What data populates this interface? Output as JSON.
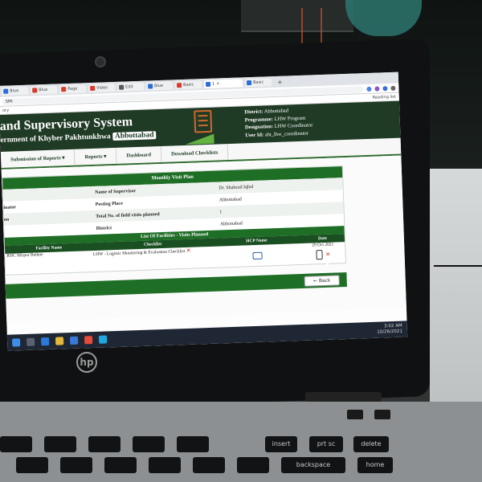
{
  "browser": {
    "tabs": [
      {
        "label": "Blue",
        "color": "#2b6cd9"
      },
      {
        "label": "Blue",
        "color": "#d93a2b"
      },
      {
        "label": "Page",
        "color": "#d93a2b"
      },
      {
        "label": "Video",
        "color": "#d93a2b"
      },
      {
        "label": "Edit",
        "color": "#5a5a5a"
      },
      {
        "label": "Blue",
        "color": "#2b6cd9"
      },
      {
        "label": "Basic",
        "color": "#d93a2b"
      },
      {
        "label": "Basic",
        "color": "#2b6cd9"
      }
    ],
    "active_tab": "1",
    "url_text": "SMI",
    "bookmark_left": "ory",
    "bookmark_right": "Reading list"
  },
  "header": {
    "title": "and Supervisory System",
    "subtitle": "ernment of Khyber Pakhtunkhwa",
    "district_chip": "Abbottabad",
    "meta": [
      {
        "key": "District:",
        "value": "Abbottabad"
      },
      {
        "key": "Programme:",
        "value": "LHW Program"
      },
      {
        "key": "Designation:",
        "value": "LHW Coordinator"
      },
      {
        "key": "User Id:",
        "value": "abt_lhw_coordinator"
      }
    ]
  },
  "menu": {
    "items": [
      "Submission of Reports",
      "Reports",
      "Dashboard",
      "Download Checklists"
    ]
  },
  "visit_plan": {
    "heading": "Monthly Visit Plan",
    "rows": [
      {
        "left": "",
        "key": "Name of Supervisor",
        "value": "Dr. Shahzad Iqbal"
      },
      {
        "left": "inator",
        "key": "Posting Place",
        "value": "Abbottabad"
      },
      {
        "left": "on",
        "key": "Total No. of field visits planned",
        "value": "1"
      },
      {
        "left": "",
        "key": "District",
        "value": "Abbottabad"
      }
    ]
  },
  "facilities": {
    "heading": "List Of Facilities - Visits Planned",
    "columns": [
      "Facility Name",
      "Checklist",
      "HCP Name",
      "Date"
    ],
    "rows": [
      {
        "facility": "RHC Mirpur Bethoe",
        "checklist": "LHW - Logistic Monitoring & Evaluation Checklist",
        "hcp": "",
        "date": "29 Oct 2021"
      }
    ],
    "back_label": "Back"
  },
  "taskbar": {
    "time": "3:02 AM",
    "date": "10/26/2021"
  },
  "hardware": {
    "brand": "hp",
    "keys": [
      "insert",
      "prt sc",
      "delete",
      "backspace",
      "home"
    ]
  }
}
